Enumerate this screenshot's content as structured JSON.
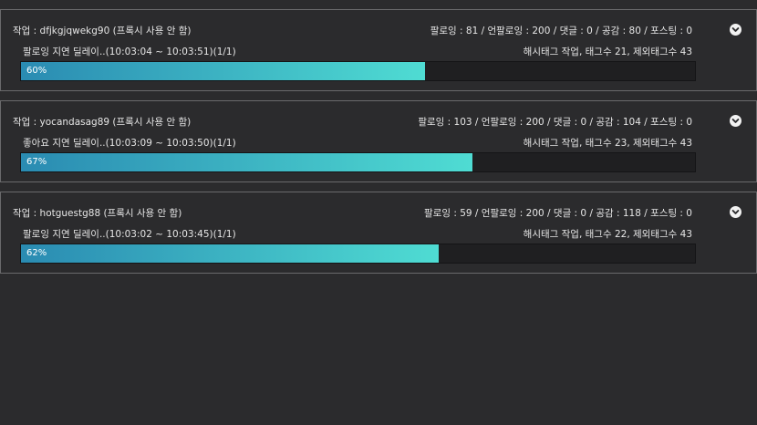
{
  "tasks": [
    {
      "title": "작업 : dfjkgjqwekg90 (프록시 사용 안 함)",
      "stats": "팔로잉 : 81 / 언팔로잉 : 200 / 댓글 : 0 / 공감 : 80 / 포스팅 : 0",
      "status": "팔로잉 지연 딜레이..(10:03:04 ~ 10:03:51)(1/1)",
      "hashtag": "해시태그 작업, 태그수 21, 제외태그수 43",
      "progress_label": "60%",
      "progress": 0.6
    },
    {
      "title": "작업 : yocandasag89 (프록시 사용 안 함)",
      "stats": "팔로잉 : 103 / 언팔로잉 : 200 / 댓글 : 0 / 공감 : 104 / 포스팅 : 0",
      "status": "좋아요 지연 딜레이..(10:03:09 ~ 10:03:50)(1/1)",
      "hashtag": "해시태그 작업, 태그수 23, 제외태그수 43",
      "progress_label": "67%",
      "progress": 0.67
    },
    {
      "title": "작업 : hotguestg88 (프록시 사용 안 함)",
      "stats": "팔로잉 : 59 / 언팔로잉 : 200 / 댓글 : 0 / 공감 : 118 / 포스팅 : 0",
      "status": "팔로잉 지연 딜레이..(10:03:02 ~ 10:03:45)(1/1)",
      "hashtag": "해시태그 작업, 태그수 22, 제외태그수 43",
      "progress_label": "62%",
      "progress": 0.62
    }
  ],
  "icons": {
    "toggle": "chevron-down-icon"
  },
  "colors": {
    "background": "#2b2b2d",
    "panel_border": "#6a6a6c",
    "progress_start": "#2a8bb2",
    "progress_end": "#4fdcd3"
  }
}
